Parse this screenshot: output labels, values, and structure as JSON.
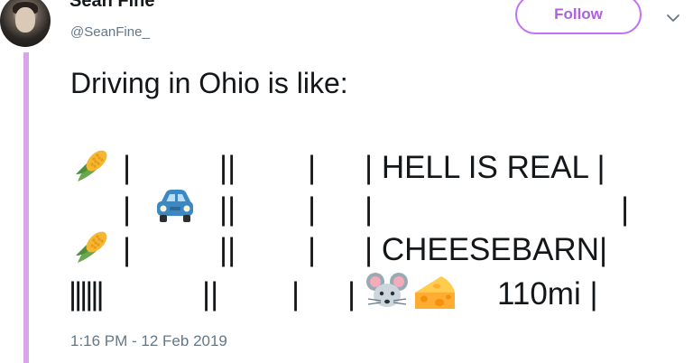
{
  "user": {
    "display_name": "Sean Fine",
    "handle": "@SeanFine_"
  },
  "follow_label": "Follow",
  "tweet": {
    "intro": "Driving in Ohio is like:",
    "rows": [
      {
        "emojis": [
          "corn"
        ],
        "segments": [
          "|",
          "||",
          "|",
          "| HELL IS REAL |"
        ]
      },
      {
        "emojis": [
          "car"
        ],
        "segments": [
          "|",
          "||",
          "|",
          "|",
          "|"
        ]
      },
      {
        "emojis": [
          "corn"
        ],
        "segments": [
          "|",
          "||",
          "|",
          "| CHEESEBARN|"
        ]
      },
      {
        "emojis": [
          "mouse",
          "cheese"
        ],
        "segments": [
          "||||||",
          "||",
          "|",
          "|",
          "110mi |"
        ]
      }
    ]
  },
  "timestamp": "1:16 PM - 12 Feb 2019",
  "colors": {
    "accent": "#c072f2",
    "thread_line": "#d9a5ea",
    "secondary_text": "#657786"
  },
  "icons": {
    "more": "chevron-down-icon"
  }
}
